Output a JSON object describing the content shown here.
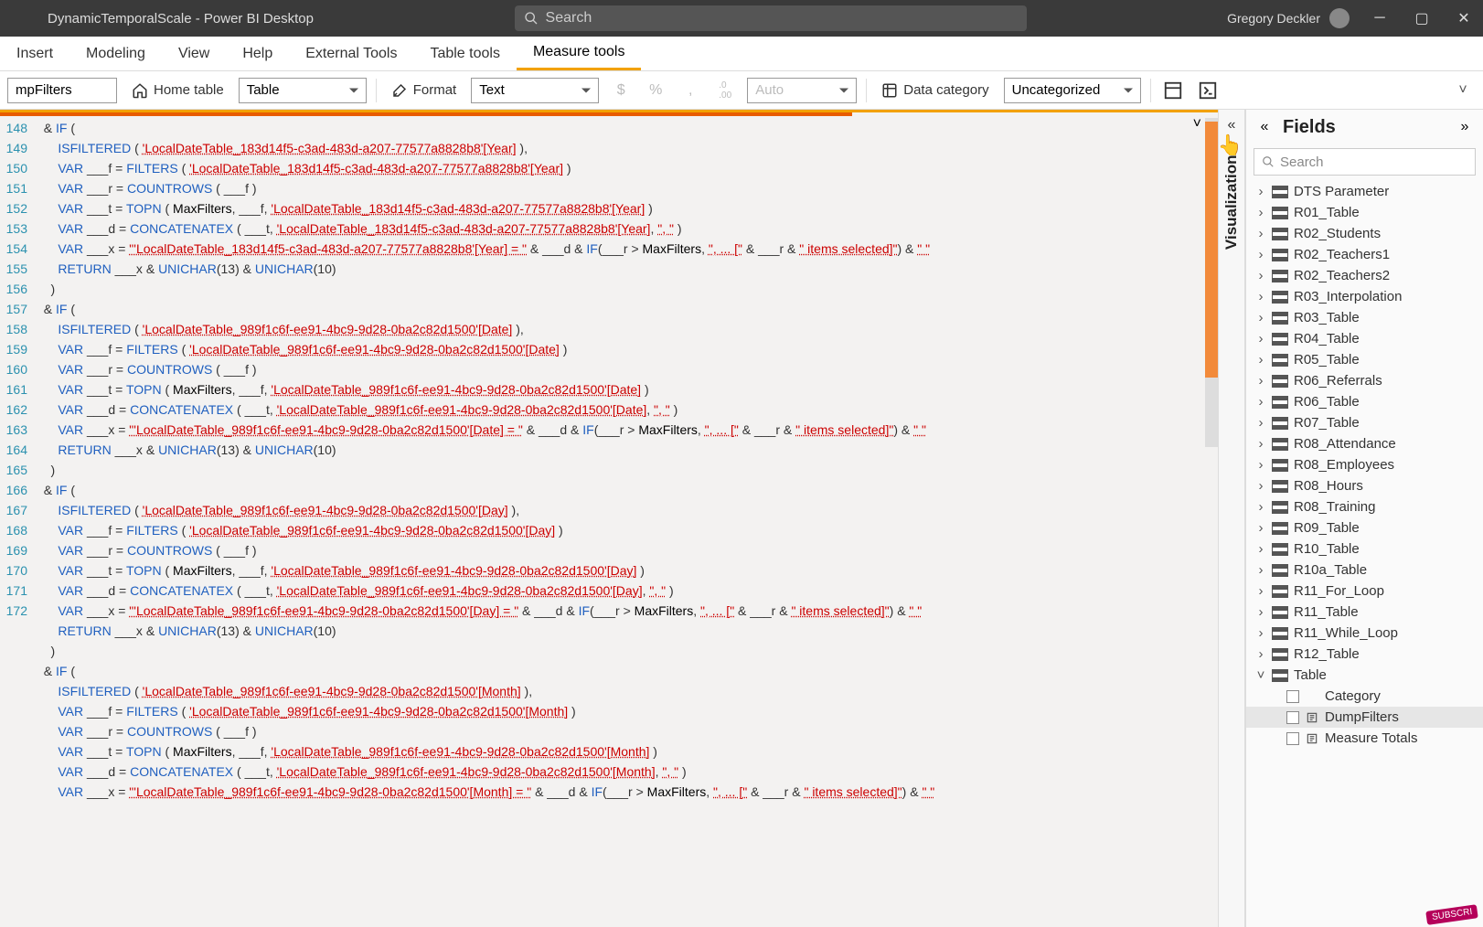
{
  "titlebar": {
    "docTitle": "DynamicTemporalScale - Power BI Desktop",
    "searchPlaceholder": "Search",
    "userName": "Gregory Deckler"
  },
  "ribbon": {
    "tabs": [
      "Insert",
      "Modeling",
      "View",
      "Help",
      "External Tools",
      "Table tools",
      "Measure tools"
    ],
    "activeIndex": 6
  },
  "toolbar": {
    "nameValue": "mpFilters",
    "homeTable": "Home table",
    "tableDD": "Table",
    "formatLabel": "Format",
    "formatDD": "Text",
    "autoLabel": "Auto",
    "dataCat": "Data category",
    "dataCatDD": "Uncategorized"
  },
  "code": {
    "lines": [
      {
        "n": 148,
        "html": "  & <span class='kw-blue'>IF</span> ("
      },
      {
        "n": 149,
        "html": "      <span class='kw-blue'>ISFILTERED</span> ( <span class='kw-red'>'LocalDateTable_183d14f5-c3ad-483d-a207-77577a8828b8'[Year]</span> ),"
      },
      {
        "n": 150,
        "html": "      <span class='kw-blue'>VAR</span> ___f = <span class='kw-blue'>FILTERS</span> ( <span class='kw-red'>'LocalDateTable_183d14f5-c3ad-483d-a207-77577a8828b8'[Year]</span> )"
      },
      {
        "n": 151,
        "html": "      <span class='kw-blue'>VAR</span> ___r = <span class='kw-blue'>COUNTROWS</span> ( ___f )"
      },
      {
        "n": 152,
        "html": "      <span class='kw-blue'>VAR</span> ___t = <span class='kw-blue'>TOPN</span> ( <span class='kw-blk'>MaxFilters</span>, ___f, <span class='kw-red'>'LocalDateTable_183d14f5-c3ad-483d-a207-77577a8828b8'[Year]</span> )"
      },
      {
        "n": 153,
        "html": "      <span class='kw-blue'>VAR</span> ___d = <span class='kw-blue'>CONCATENATEX</span> ( ___t, <span class='kw-red'>'LocalDateTable_183d14f5-c3ad-483d-a207-77577a8828b8'[Year]</span>, <span class='kw-red'>\", \"</span> )"
      },
      {
        "n": 154,
        "html": "      <span class='kw-blue'>VAR</span> ___x = <span class='kw-red'>\"'LocalDateTable_183d14f5-c3ad-483d-a207-77577a8828b8'[Year] = \"</span> & ___d & <span class='kw-blue'>IF</span>(___r > <span class='kw-blk'>MaxFilters</span>, <span class='kw-red'>\", ... [\"</span> & ___r & <span class='kw-red'>\" items selected]\"</span>) & <span class='kw-red'>\" \"</span>"
      },
      {
        "n": 155,
        "html": "      <span class='kw-blue'>RETURN</span> ___x & <span class='kw-blue'>UNICHAR</span>(13) & <span class='kw-blue'>UNICHAR</span>(10)"
      },
      {
        "n": 156,
        "html": "    )"
      },
      {
        "n": 157,
        "html": "  & <span class='kw-blue'>IF</span> ("
      },
      {
        "n": 158,
        "html": "      <span class='kw-blue'>ISFILTERED</span> ( <span class='kw-red'>'LocalDateTable_989f1c6f-ee91-4bc9-9d28-0ba2c82d1500'[Date]</span> ),"
      },
      {
        "n": 159,
        "html": "      <span class='kw-blue'>VAR</span> ___f = <span class='kw-blue'>FILTERS</span> ( <span class='kw-red'>'LocalDateTable_989f1c6f-ee91-4bc9-9d28-0ba2c82d1500'[Date]</span> )"
      },
      {
        "n": 160,
        "html": "      <span class='kw-blue'>VAR</span> ___r = <span class='kw-blue'>COUNTROWS</span> ( ___f )"
      },
      {
        "n": 161,
        "html": "      <span class='kw-blue'>VAR</span> ___t = <span class='kw-blue'>TOPN</span> ( <span class='kw-blk'>MaxFilters</span>, ___f, <span class='kw-red'>'LocalDateTable_989f1c6f-ee91-4bc9-9d28-0ba2c82d1500'[Date]</span> )"
      },
      {
        "n": 162,
        "html": "      <span class='kw-blue'>VAR</span> ___d = <span class='kw-blue'>CONCATENATEX</span> ( ___t, <span class='kw-red'>'LocalDateTable_989f1c6f-ee91-4bc9-9d28-0ba2c82d1500'[Date]</span>, <span class='kw-red'>\", \"</span> )"
      },
      {
        "n": 163,
        "html": "      <span class='kw-blue'>VAR</span> ___x = <span class='kw-red'>\"'LocalDateTable_989f1c6f-ee91-4bc9-9d28-0ba2c82d1500'[Date] = \"</span> & ___d & <span class='kw-blue'>IF</span>(___r > <span class='kw-blk'>MaxFilters</span>, <span class='kw-red'>\", ... [\"</span> & ___r & <span class='kw-red'>\" items selected]\"</span>) & <span class='kw-red'>\" \"</span>"
      },
      {
        "n": 164,
        "html": "      <span class='kw-blue'>RETURN</span> ___x & <span class='kw-blue'>UNICHAR</span>(13) & <span class='kw-blue'>UNICHAR</span>(10)"
      },
      {
        "n": 165,
        "html": "    )"
      },
      {
        "n": 166,
        "html": "  & <span class='kw-blue'>IF</span> ("
      },
      {
        "n": 167,
        "html": "      <span class='kw-blue'>ISFILTERED</span> ( <span class='kw-red'>'LocalDateTable_989f1c6f-ee91-4bc9-9d28-0ba2c82d1500'[Day]</span> ),"
      },
      {
        "n": 168,
        "html": "      <span class='kw-blue'>VAR</span> ___f = <span class='kw-blue'>FILTERS</span> ( <span class='kw-red'>'LocalDateTable_989f1c6f-ee91-4bc9-9d28-0ba2c82d1500'[Day]</span> )"
      },
      {
        "n": 169,
        "html": "      <span class='kw-blue'>VAR</span> ___r = <span class='kw-blue'>COUNTROWS</span> ( ___f )"
      },
      {
        "n": 170,
        "html": "      <span class='kw-blue'>VAR</span> ___t = <span class='kw-blue'>TOPN</span> ( <span class='kw-blk'>MaxFilters</span>, ___f, <span class='kw-red'>'LocalDateTable_989f1c6f-ee91-4bc9-9d28-0ba2c82d1500'[Day]</span> )"
      },
      {
        "n": 171,
        "html": "      <span class='kw-blue'>VAR</span> ___d = <span class='kw-blue'>CONCATENATEX</span> ( ___t, <span class='kw-red'>'LocalDateTable_989f1c6f-ee91-4bc9-9d28-0ba2c82d1500'[Day]</span>, <span class='kw-red'>\", \"</span> )"
      },
      {
        "n": 172,
        "html": "      <span class='kw-blue'>VAR</span> ___x = <span class='kw-red'>\"'LocalDateTable_989f1c6f-ee91-4bc9-9d28-0ba2c82d1500'[Day] = \"</span> & ___d & <span class='kw-blue'>IF</span>(___r > <span class='kw-blk'>MaxFilters</span>, <span class='kw-red'>\", ... [\"</span> & ___r & <span class='kw-red'>\" items selected]\"</span>) & <span class='kw-red'>\" \"</span>"
      },
      {
        "n": 0,
        "html": "      <span class='kw-blue'>RETURN</span> ___x & <span class='kw-blue'>UNICHAR</span>(13) & <span class='kw-blue'>UNICHAR</span>(10)"
      },
      {
        "n": 0,
        "html": "    )"
      },
      {
        "n": 0,
        "html": "  & <span class='kw-blue'>IF</span> ("
      },
      {
        "n": 0,
        "html": "      <span class='kw-blue'>ISFILTERED</span> ( <span class='kw-red'>'LocalDateTable_989f1c6f-ee91-4bc9-9d28-0ba2c82d1500'[Month]</span> ),"
      },
      {
        "n": 0,
        "html": "      <span class='kw-blue'>VAR</span> ___f = <span class='kw-blue'>FILTERS</span> ( <span class='kw-red'>'LocalDateTable_989f1c6f-ee91-4bc9-9d28-0ba2c82d1500'[Month]</span> )"
      },
      {
        "n": 0,
        "html": "      <span class='kw-blue'>VAR</span> ___r = <span class='kw-blue'>COUNTROWS</span> ( ___f )"
      },
      {
        "n": 0,
        "html": "      <span class='kw-blue'>VAR</span> ___t = <span class='kw-blue'>TOPN</span> ( <span class='kw-blk'>MaxFilters</span>, ___f, <span class='kw-red'>'LocalDateTable_989f1c6f-ee91-4bc9-9d28-0ba2c82d1500'[Month]</span> )"
      },
      {
        "n": 0,
        "html": "      <span class='kw-blue'>VAR</span> ___d = <span class='kw-blue'>CONCATENATEX</span> ( ___t, <span class='kw-red'>'LocalDateTable_989f1c6f-ee91-4bc9-9d28-0ba2c82d1500'[Month]</span>, <span class='kw-red'>\", \"</span> )"
      },
      {
        "n": 0,
        "html": "      <span class='kw-blue'>VAR</span> ___x = <span class='kw-red'>\"'LocalDateTable_989f1c6f-ee91-4bc9-9d28-0ba2c82d1500'[Month] = \"</span> & ___d & <span class='kw-blue'>IF</span>(___r > <span class='kw-blk'>MaxFilters</span>, <span class='kw-red'>\", ... [\"</span> & ___r & <span class='kw-red'>\" items selected]\"</span>) & <span class='kw-red'>\" \"</span>"
      }
    ]
  },
  "viz": {
    "label": "Visualizations"
  },
  "fields": {
    "title": "Fields",
    "searchPlaceholder": "Search",
    "tables": [
      {
        "name": "DTS Parameter",
        "expanded": false
      },
      {
        "name": "R01_Table",
        "expanded": false
      },
      {
        "name": "R02_Students",
        "expanded": false
      },
      {
        "name": "R02_Teachers1",
        "expanded": false
      },
      {
        "name": "R02_Teachers2",
        "expanded": false
      },
      {
        "name": "R03_Interpolation",
        "expanded": false
      },
      {
        "name": "R03_Table",
        "expanded": false
      },
      {
        "name": "R04_Table",
        "expanded": false
      },
      {
        "name": "R05_Table",
        "expanded": false
      },
      {
        "name": "R06_Referrals",
        "expanded": false
      },
      {
        "name": "R06_Table",
        "expanded": false
      },
      {
        "name": "R07_Table",
        "expanded": false
      },
      {
        "name": "R08_Attendance",
        "expanded": false
      },
      {
        "name": "R08_Employees",
        "expanded": false
      },
      {
        "name": "R08_Hours",
        "expanded": false
      },
      {
        "name": "R08_Training",
        "expanded": false
      },
      {
        "name": "R09_Table",
        "expanded": false
      },
      {
        "name": "R10_Table",
        "expanded": false
      },
      {
        "name": "R10a_Table",
        "expanded": false
      },
      {
        "name": "R11_For_Loop",
        "expanded": false
      },
      {
        "name": "R11_Table",
        "expanded": false
      },
      {
        "name": "R11_While_Loop",
        "expanded": false
      },
      {
        "name": "R12_Table",
        "expanded": false
      },
      {
        "name": "Table",
        "expanded": true,
        "fields": [
          {
            "name": "Category",
            "icon": "none",
            "selected": false
          },
          {
            "name": "DumpFilters",
            "icon": "measure",
            "selected": true
          },
          {
            "name": "Measure Totals",
            "icon": "measure",
            "selected": false
          }
        ]
      }
    ]
  },
  "badge": "SUBSCRI"
}
